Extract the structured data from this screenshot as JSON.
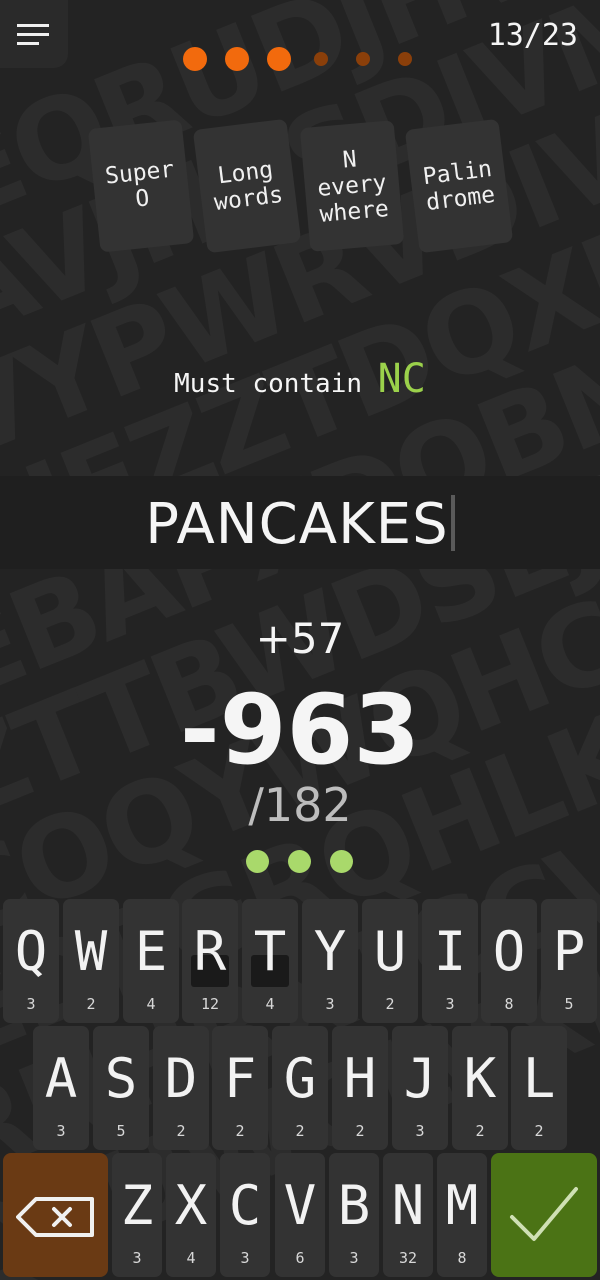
{
  "header": {
    "menu_icon": "hamburger-menu-icon",
    "counter": "13/23",
    "progress": {
      "total": 6,
      "completed": 3,
      "completed_color": "#f26a0d",
      "pending_color": "#8a3f0a"
    }
  },
  "bonuses": [
    {
      "label": "Super\nO"
    },
    {
      "label": "Long\nwords"
    },
    {
      "label": "N\nevery\nwhere"
    },
    {
      "label": "Palin\ndrome"
    }
  ],
  "rule": {
    "prefix": "Must contain",
    "letters": "NC",
    "highlight_color": "#9bd14b"
  },
  "current_word": "PANCAKES",
  "score": {
    "gain": "+57",
    "total": "-963",
    "target": "/182"
  },
  "lives": {
    "count": 3,
    "color": "#a9d96b"
  },
  "keyboard": {
    "rows": [
      [
        {
          "letter": "Q",
          "value": "3"
        },
        {
          "letter": "W",
          "value": "2"
        },
        {
          "letter": "E",
          "value": "4"
        },
        {
          "letter": "R",
          "value": "12"
        },
        {
          "letter": "T",
          "value": "4"
        },
        {
          "letter": "Y",
          "value": "3"
        },
        {
          "letter": "U",
          "value": "2"
        },
        {
          "letter": "I",
          "value": "3"
        },
        {
          "letter": "O",
          "value": "8"
        },
        {
          "letter": "P",
          "value": "5"
        }
      ],
      [
        {
          "letter": "A",
          "value": "3"
        },
        {
          "letter": "S",
          "value": "5"
        },
        {
          "letter": "D",
          "value": "2"
        },
        {
          "letter": "F",
          "value": "2"
        },
        {
          "letter": "G",
          "value": "2"
        },
        {
          "letter": "H",
          "value": "2"
        },
        {
          "letter": "J",
          "value": "3"
        },
        {
          "letter": "K",
          "value": "2"
        },
        {
          "letter": "L",
          "value": "2"
        }
      ],
      [
        {
          "letter": "Z",
          "value": "3"
        },
        {
          "letter": "X",
          "value": "4"
        },
        {
          "letter": "C",
          "value": "3"
        },
        {
          "letter": "V",
          "value": "6"
        },
        {
          "letter": "B",
          "value": "3"
        },
        {
          "letter": "N",
          "value": "32"
        },
        {
          "letter": "M",
          "value": "8"
        }
      ]
    ],
    "marked_keys": [
      "R",
      "T"
    ],
    "delete_icon": "backspace-icon",
    "delete_color": "#6a3a14",
    "submit_icon": "checkmark-icon",
    "submit_color": "#4b7315"
  }
}
